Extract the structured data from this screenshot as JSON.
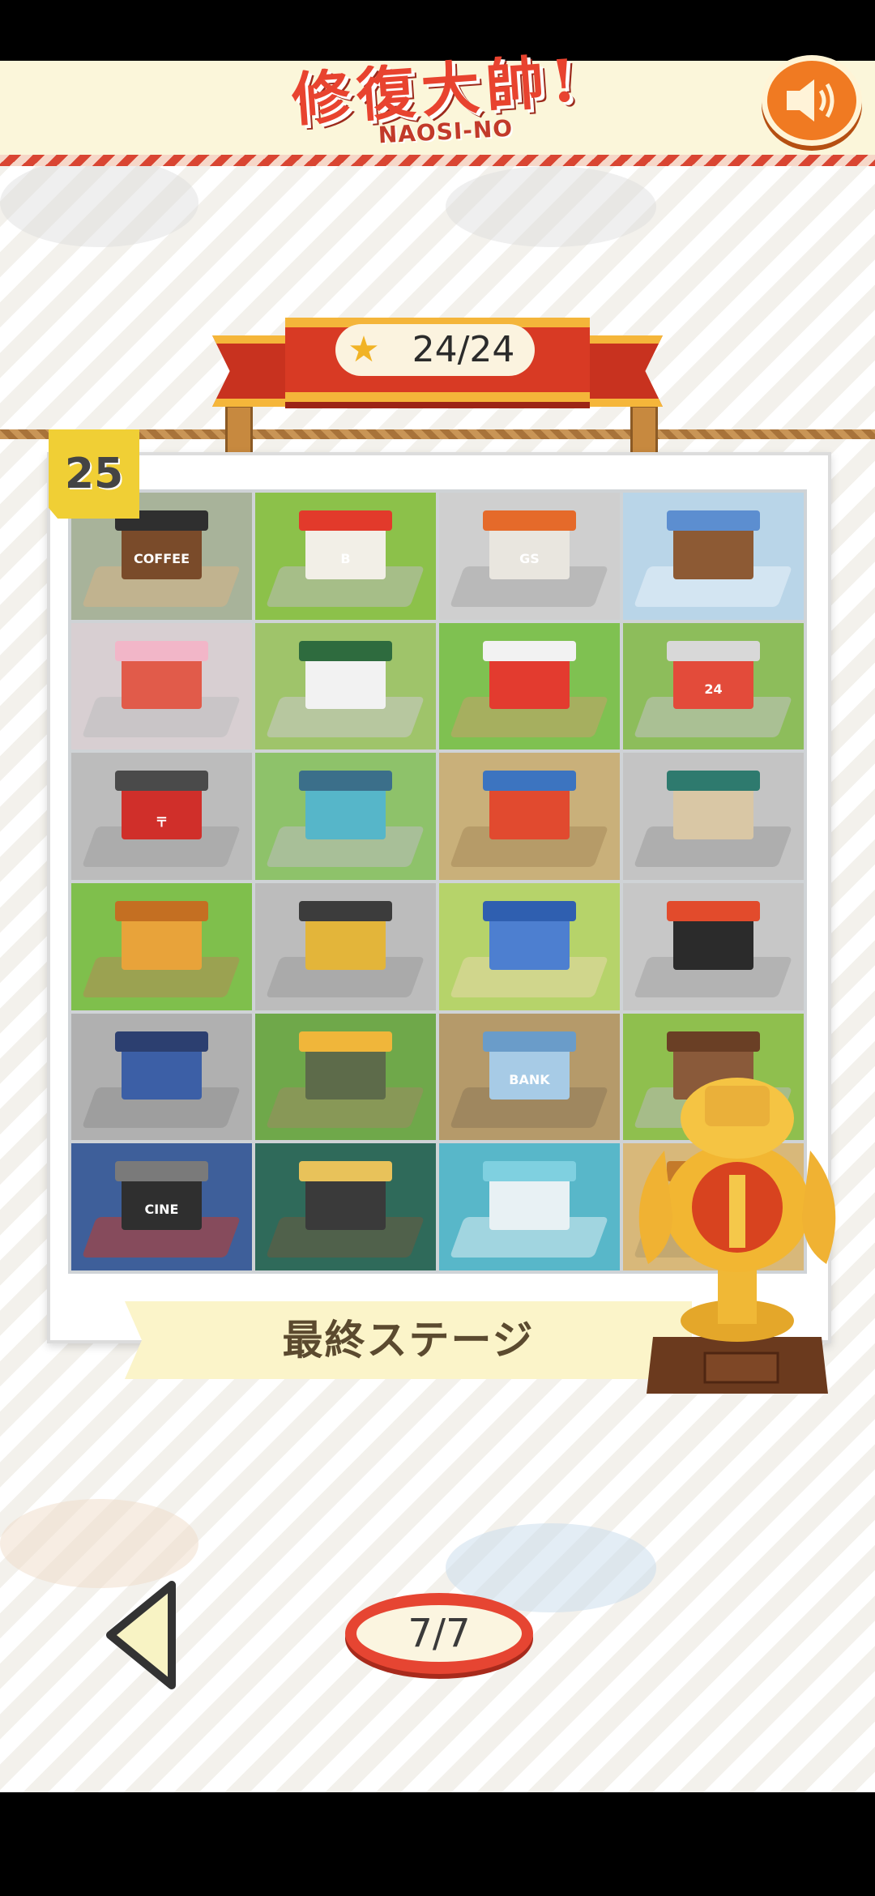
{
  "header": {
    "logo_jp": "修復大帥!",
    "logo_en": "NAOSI-NO",
    "sound_icon": "speaker-icon"
  },
  "progress": {
    "star_icon": "star-icon",
    "stars": "24/24"
  },
  "stage": {
    "number": "25",
    "title": "最終ステージ",
    "tiles": [
      {
        "name": "coffee-shop",
        "label": "COFFEE",
        "bg": "#a8b39a",
        "bldg": "#7a4b2a",
        "roof": "#2f2f2f",
        "ground": "#d5b286"
      },
      {
        "name": "burger-shop",
        "label": "B",
        "bg": "#8cc14a",
        "bldg": "#f2efe7",
        "roof": "#e23a2b",
        "ground": "#bcbcbc"
      },
      {
        "name": "gas-station",
        "label": "GS",
        "bg": "#cfcfcf",
        "bldg": "#e9e6df",
        "roof": "#e56a2a",
        "ground": "#a7a7a7"
      },
      {
        "name": "winter-cabin",
        "label": "",
        "bg": "#b9d5e8",
        "bldg": "#8d5a34",
        "roof": "#5c8ed0",
        "ground": "#eaf3fa"
      },
      {
        "name": "crane-game",
        "label": "",
        "bg": "#d8cfd2",
        "bldg": "#e15b4a",
        "roof": "#f2b6c8",
        "ground": "#bdbdbd"
      },
      {
        "name": "flower-shop",
        "label": "",
        "bg": "#9fc46a",
        "bldg": "#f2f2f2",
        "roof": "#2e6b3e",
        "ground": "#cbcbcb"
      },
      {
        "name": "circus-tent",
        "label": "",
        "bg": "#7fc151",
        "bldg": "#e33b2f",
        "roof": "#f2f2f2",
        "ground": "#c7a06b"
      },
      {
        "name": "convenience-store",
        "label": "24",
        "bg": "#8dbd5b",
        "bldg": "#e34b3a",
        "roof": "#d8d8d8",
        "ground": "#c2c2c2"
      },
      {
        "name": "post-office",
        "label": "〒",
        "bg": "#bcbcbc",
        "bldg": "#d02f2a",
        "roof": "#4a4a4a",
        "ground": "#9e9e9e"
      },
      {
        "name": "power-plant",
        "label": "",
        "bg": "#8ec26a",
        "bldg": "#56b6c9",
        "roof": "#3b6f8a",
        "ground": "#bdbdbd"
      },
      {
        "name": "night-market",
        "label": "",
        "bg": "#c9b07a",
        "bldg": "#e14a2f",
        "roof": "#3c74c0",
        "ground": "#a58a5a"
      },
      {
        "name": "fish-market",
        "label": "",
        "bg": "#c4c4c4",
        "bldg": "#d9c7a5",
        "roof": "#2e7a6e",
        "ground": "#9d9d9d"
      },
      {
        "name": "bakery",
        "label": "",
        "bg": "#7fbf4c",
        "bldg": "#e8a33a",
        "roof": "#c46f22",
        "ground": "#b38a55"
      },
      {
        "name": "restaurant",
        "label": "",
        "bg": "#bcbcbc",
        "bldg": "#e3b53a",
        "roof": "#3c3c3c",
        "ground": "#9a9a9a"
      },
      {
        "name": "farm-house",
        "label": "",
        "bg": "#b6d36a",
        "bldg": "#4d7fd0",
        "roof": "#2f5fb0",
        "ground": "#e6d9a8"
      },
      {
        "name": "pizza-shop",
        "label": "",
        "bg": "#c7c7c7",
        "bldg": "#2b2b2b",
        "roof": "#e24b2c",
        "ground": "#a2a2a2"
      },
      {
        "name": "apartment",
        "label": "",
        "bg": "#b0b0b0",
        "bldg": "#3c5fa6",
        "roof": "#2c3f70",
        "ground": "#8f8f8f"
      },
      {
        "name": "tea-house",
        "label": "",
        "bg": "#6fa84a",
        "bldg": "#5d6b4a",
        "roof": "#f0b63a",
        "ground": "#9c8a62"
      },
      {
        "name": "bank",
        "label": "BANK",
        "bg": "#b59a6a",
        "bldg": "#a7cbe6",
        "roof": "#6a9cc9",
        "ground": "#8d7855"
      },
      {
        "name": "train-station",
        "label": "",
        "bg": "#8fbf4e",
        "bldg": "#8a5a3a",
        "roof": "#6a3f25",
        "ground": "#b9b9b9"
      },
      {
        "name": "cinema",
        "label": "CINE",
        "bg": "#3e5f9a",
        "bldg": "#2f2f2f",
        "roof": "#7a7a7a",
        "ground": "#c13a2a"
      },
      {
        "name": "record-shop",
        "label": "",
        "bg": "#2f6a5a",
        "bldg": "#3a3a3a",
        "roof": "#e8c25a",
        "ground": "#6b5a3f"
      },
      {
        "name": "aquarium",
        "label": "",
        "bg": "#58b7c9",
        "bldg": "#e8f1f4",
        "roof": "#7fd0e0",
        "ground": "#dfeef2"
      },
      {
        "name": "final-locked",
        "label": "",
        "bg": "#d8b87a",
        "bldg": "#8a5a3a",
        "roof": "#c47a2a",
        "ground": "#b39a6a"
      }
    ]
  },
  "trophy_icon": "trophy-icon",
  "navigation": {
    "prev_icon": "left-triangle-icon",
    "page": "7/7"
  }
}
